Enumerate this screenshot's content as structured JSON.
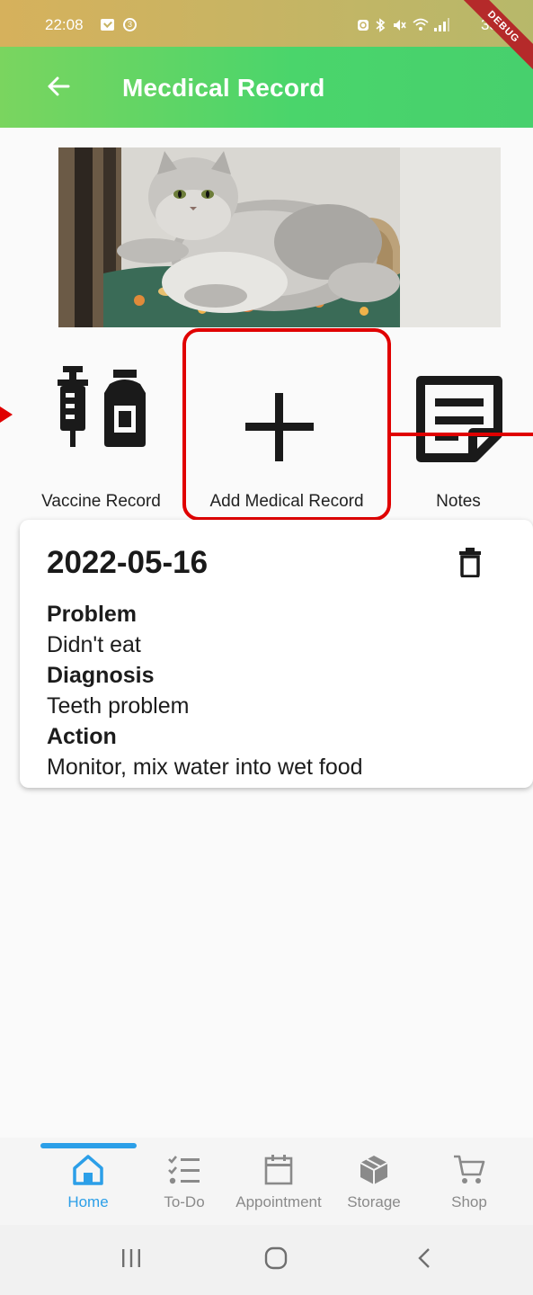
{
  "status_bar": {
    "time": "22:08",
    "battery": "35%",
    "debug_ribbon": "DEBUG",
    "icons": [
      "message-icon",
      "sync-icon",
      "alarm-icon",
      "bluetooth-icon",
      "mute-icon",
      "wifi-icon",
      "signal-icon"
    ]
  },
  "app_bar": {
    "back_icon": "arrow-left-icon",
    "title": "Mecdical Record"
  },
  "actions": {
    "vaccine": {
      "label": "Vaccine Record",
      "icon": "vaccine-icon"
    },
    "add": {
      "label": "Add Medical Record",
      "icon": "plus-icon"
    },
    "notes": {
      "label": "Notes",
      "icon": "notes-icon"
    }
  },
  "record": {
    "date": "2022-05-16",
    "problem_label": "Problem",
    "problem": "Didn't eat",
    "diagnosis_label": "Diagnosis",
    "diagnosis": "Teeth problem",
    "action_label": "Action",
    "action": "Monitor, mix water into wet food",
    "delete_icon": "trash-icon"
  },
  "bottom_nav": {
    "items": [
      {
        "label": "Home",
        "icon": "home-icon",
        "active": true
      },
      {
        "label": "To-Do",
        "icon": "checklist-icon",
        "active": false
      },
      {
        "label": "Appointment",
        "icon": "calendar-icon",
        "active": false
      },
      {
        "label": "Storage",
        "icon": "box-icon",
        "active": false
      },
      {
        "label": "Shop",
        "icon": "cart-icon",
        "active": false
      }
    ]
  },
  "colors": {
    "app_bar": "#4ad56b",
    "accent": "#2c9fe8",
    "highlight": "#e00000",
    "debug": "#b52a2a"
  }
}
